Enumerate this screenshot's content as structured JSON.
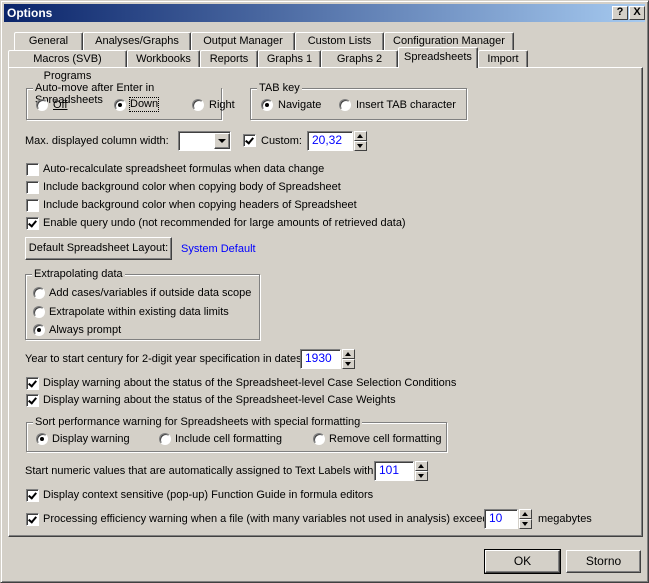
{
  "window": {
    "title": "Options",
    "help_label": "?",
    "close_label": "X"
  },
  "tabs_row1": [
    "General",
    "Analyses/Graphs",
    "Output Manager",
    "Custom Lists",
    "Configuration Manager"
  ],
  "tabs_row2": [
    "Macros (SVB) Programs",
    "Workbooks",
    "Reports",
    "Graphs 1",
    "Graphs 2",
    "Spreadsheets",
    "Import"
  ],
  "active_tab": "Spreadsheets",
  "automove": {
    "label": "Auto-move after Enter in Spreadsheets",
    "options": [
      "Off",
      "Down",
      "Right"
    ],
    "selected": "Down"
  },
  "tabkey": {
    "label": "TAB key",
    "options": [
      "Navigate",
      "Insert TAB character"
    ],
    "selected": "Navigate"
  },
  "column_width": {
    "label": "Max. displayed column width:",
    "dropdown_value": "",
    "custom_label": "Custom:",
    "custom_checked": true,
    "custom_value": "20,32"
  },
  "checkboxes1": [
    {
      "label": "Auto-recalculate spreadsheet formulas when data change",
      "checked": false
    },
    {
      "label": "Include background color when copying body of Spreadsheet",
      "checked": false
    },
    {
      "label": "Include background color when copying headers of Spreadsheet",
      "checked": false
    },
    {
      "label": "Enable query undo (not recommended for large amounts of retrieved data)",
      "checked": true
    }
  ],
  "layout": {
    "button_label": "Default Spreadsheet Layout:",
    "value": "System Default"
  },
  "extrapolating": {
    "label": "Extrapolating data",
    "options": [
      "Add cases/variables if outside data scope",
      "Extrapolate within existing data limits",
      "Always prompt"
    ],
    "selected": "Always prompt"
  },
  "year": {
    "label": "Year to start century for 2-digit year specification in dates:",
    "value": "1930"
  },
  "checkboxes2": [
    {
      "label": "Display warning about the status of the Spreadsheet-level Case Selection Conditions",
      "checked": true
    },
    {
      "label": "Display warning about the status of the Spreadsheet-level Case Weights",
      "checked": true
    }
  ],
  "sortwarn": {
    "label": "Sort performance warning for Spreadsheets with special formatting",
    "options": [
      "Display warning",
      "Include cell formatting",
      "Remove cell formatting"
    ],
    "selected": "Display warning"
  },
  "textlabels": {
    "label": "Start numeric values that are automatically assigned to Text Labels with:",
    "value": "101"
  },
  "function_guide": {
    "label": "Display context sensitive (pop-up) Function Guide in formula editors",
    "checked": true
  },
  "efficiency": {
    "label": "Processing efficiency warning when a file (with many variables not used in analysis) exceeds:",
    "checked": true,
    "value": "10",
    "unit": "megabytes"
  },
  "footer": {
    "ok_label": "OK",
    "cancel_label": "Storno"
  }
}
